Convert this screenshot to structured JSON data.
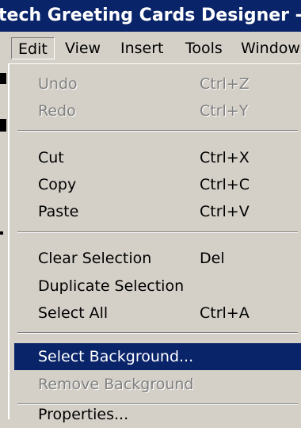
{
  "window": {
    "title": "tech Greeting Cards Designer - [G"
  },
  "menubar": {
    "items": [
      "Edit",
      "View",
      "Insert",
      "Tools",
      "Window"
    ],
    "active": "Edit"
  },
  "edit_menu": {
    "items": [
      {
        "label": "Undo",
        "shortcut": "Ctrl+Z",
        "enabled": false
      },
      {
        "label": "Redo",
        "shortcut": "Ctrl+Y",
        "enabled": false
      },
      {
        "label": "Cut",
        "shortcut": "Ctrl+X",
        "enabled": true
      },
      {
        "label": "Copy",
        "shortcut": "Ctrl+C",
        "enabled": true
      },
      {
        "label": "Paste",
        "shortcut": "Ctrl+V",
        "enabled": true
      },
      {
        "label": "Clear Selection",
        "shortcut": "Del",
        "enabled": true
      },
      {
        "label": "Duplicate Selection",
        "shortcut": "",
        "enabled": true
      },
      {
        "label": "Select All",
        "shortcut": "Ctrl+A",
        "enabled": true
      },
      {
        "label": "Select Background...",
        "shortcut": "",
        "enabled": true,
        "highlighted": true
      },
      {
        "label": "Remove Background",
        "shortcut": "",
        "enabled": false
      },
      {
        "label": "Properties...",
        "shortcut": "",
        "enabled": true
      }
    ]
  },
  "colors": {
    "face": "#d4d0c8",
    "title_bar": "#0a246a",
    "highlight": "#0a246a",
    "disabled_text": "#808080"
  }
}
